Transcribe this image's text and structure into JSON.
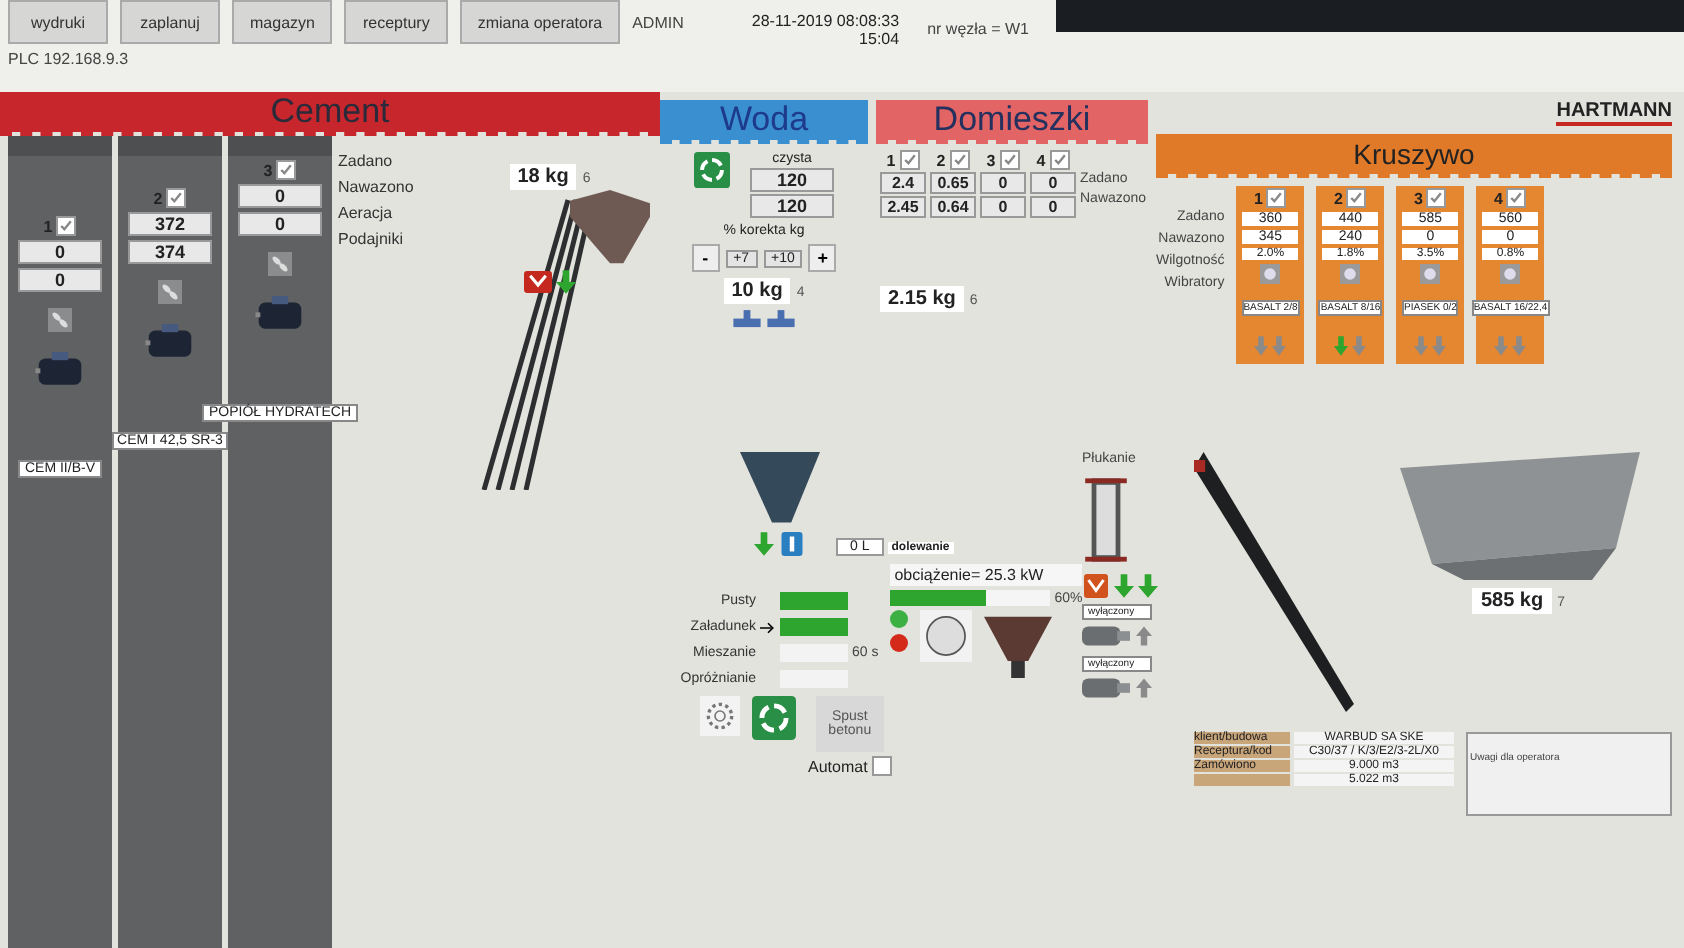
{
  "toolbar": {
    "buttons": [
      {
        "label": "wydruki"
      },
      {
        "label": "zaplanuj"
      },
      {
        "label": "magazyn"
      },
      {
        "label": "receptury"
      },
      {
        "label": "zmiana operatora"
      }
    ],
    "user": "ADMIN",
    "plc": "PLC 192.168.9.3",
    "datetime": "28-11-2019 08:08:33",
    "time": "15:04",
    "node": "nr węzła = W1"
  },
  "logo": "HARTMANN",
  "cement": {
    "title": "Cement",
    "row_labels": [
      "Zadano",
      "Nawazono",
      "Aeracja",
      "Podajniki"
    ],
    "weight": "18 kg",
    "count": "6",
    "silos": [
      {
        "number": "1",
        "checked": true,
        "set": "0",
        "weighed": "0",
        "name": "CEM II/B-V"
      },
      {
        "number": "2",
        "checked": true,
        "set": "372",
        "weighed": "374",
        "name": "CEM I 42,5 SR-3"
      },
      {
        "number": "3",
        "checked": true,
        "set": "0",
        "weighed": "0",
        "name": "POPIÓŁ HYDRATECH"
      }
    ]
  },
  "water": {
    "title": "Woda",
    "label": "czysta",
    "set": "120",
    "weighed": "120",
    "correction_label": "% korekta kg",
    "minus": "-",
    "plus": "+",
    "corrections": [
      "+7",
      "+10"
    ],
    "weight": "10 kg",
    "count": "4"
  },
  "admixtures": {
    "title": "Domieszki",
    "row_labels": [
      "Zadano",
      "Nawazono"
    ],
    "weight": "2.15 kg",
    "count": "6",
    "columns": [
      {
        "number": "1",
        "checked": true,
        "set": "2.4",
        "weighed": "2.45"
      },
      {
        "number": "2",
        "checked": true,
        "set": "0.65",
        "weighed": "0.64"
      },
      {
        "number": "3",
        "checked": true,
        "set": "0",
        "weighed": "0"
      },
      {
        "number": "4",
        "checked": true,
        "set": "0",
        "weighed": "0"
      }
    ]
  },
  "aggregate": {
    "title": "Kruszywo",
    "row_labels": [
      "Zadano",
      "Nawazono",
      "Wilgotność",
      "Wibratory"
    ],
    "weight": "585 kg",
    "count": "7",
    "bins": [
      {
        "number": "1",
        "checked": true,
        "set": "360",
        "weighed": "345",
        "moisture": "2.0%",
        "name": "BASALT 2/8",
        "outlets": [
          false,
          false
        ]
      },
      {
        "number": "2",
        "checked": true,
        "set": "440",
        "weighed": "240",
        "moisture": "1.8%",
        "name": "BASALT 8/16",
        "outlets": [
          true,
          false
        ]
      },
      {
        "number": "3",
        "checked": true,
        "set": "585",
        "weighed": "0",
        "moisture": "3.5%",
        "name": "PIASEK 0/2",
        "outlets": [
          false,
          false
        ]
      },
      {
        "number": "4",
        "checked": true,
        "set": "560",
        "weighed": "0",
        "moisture": "0.8%",
        "name": "BASALT 16/22,4",
        "outlets": [
          false,
          false
        ]
      }
    ]
  },
  "rinse": {
    "label": "Płukanie"
  },
  "pumps": [
    {
      "label": "wyłączony"
    },
    {
      "label": "wyłączony"
    }
  ],
  "mixer": {
    "steps": [
      {
        "label": "Pusty",
        "done": true,
        "current": false
      },
      {
        "label": "Załadunek",
        "done": true,
        "current": true
      },
      {
        "label": "Mieszanie",
        "done": false,
        "current": false
      },
      {
        "label": "Opróżnianie",
        "done": false,
        "current": false
      }
    ],
    "mix_time": "60 s",
    "water_dose": "0 L",
    "water_label": "dolewanie",
    "load_label": "obciążenie= 25.3 kW",
    "load": {
      "level": 0.6
    },
    "load_percent": "60%",
    "lamps": [
      {
        "color": "#3cb043"
      },
      {
        "color": "#d42a1a"
      }
    ],
    "discharge_button": "Spust betonu",
    "automat": {
      "label": "Automat",
      "checked": false
    }
  },
  "order": {
    "rows": [
      {
        "label": "klient/budowa",
        "value": "WARBUD SA SKE"
      },
      {
        "label": "Receptura/kod",
        "value": "C30/37 / K/3/E2/3-2L/X0"
      },
      {
        "label": "Zamówiono",
        "value": "9.000 m3"
      },
      {
        "label": "",
        "value": "5.022 m3"
      }
    ]
  },
  "notes": {
    "label": "Uwagi dla operatora"
  }
}
